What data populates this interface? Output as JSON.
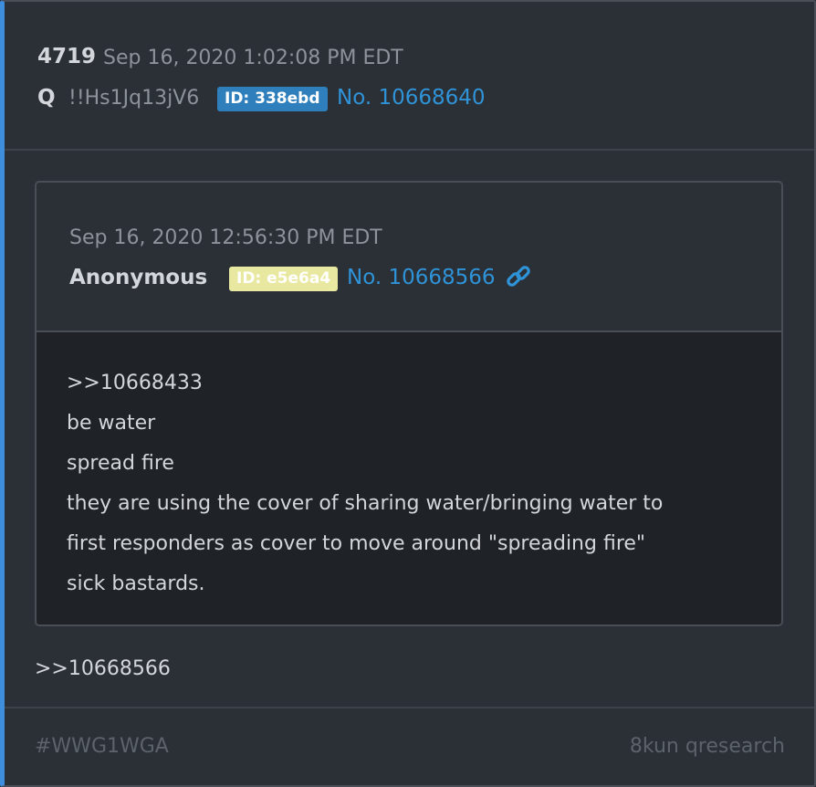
{
  "post": {
    "number": "4719",
    "timestamp": "Sep 16, 2020 1:02:08 PM EDT",
    "author": "Q",
    "tripcode": "!!Hs1Jq13jV6",
    "id_label": "ID: 338ebd",
    "post_link": "No. 10668640"
  },
  "quoted": {
    "timestamp": "Sep 16, 2020 12:56:30 PM EDT",
    "author": "Anonymous",
    "id_label": "ID: e5e6a4",
    "post_link": "No. 10668566",
    "link_icon": "link-icon",
    "lines": [
      ">>10668433",
      "be water",
      "spread fire",
      "they are using the cover of sharing water/bringing water to",
      "first responders as cover to move around \"spreading fire\"",
      "sick bastards."
    ]
  },
  "reply": ">>10668566",
  "footer": {
    "hashtag": "#WWG1WGA",
    "source": "8kun qresearch"
  },
  "colors": {
    "accent_border": "#3f8ede",
    "id_badge_q": "#2f7fbd",
    "id_badge_anon": "#e9e8a0",
    "link": "#2f93d8"
  }
}
